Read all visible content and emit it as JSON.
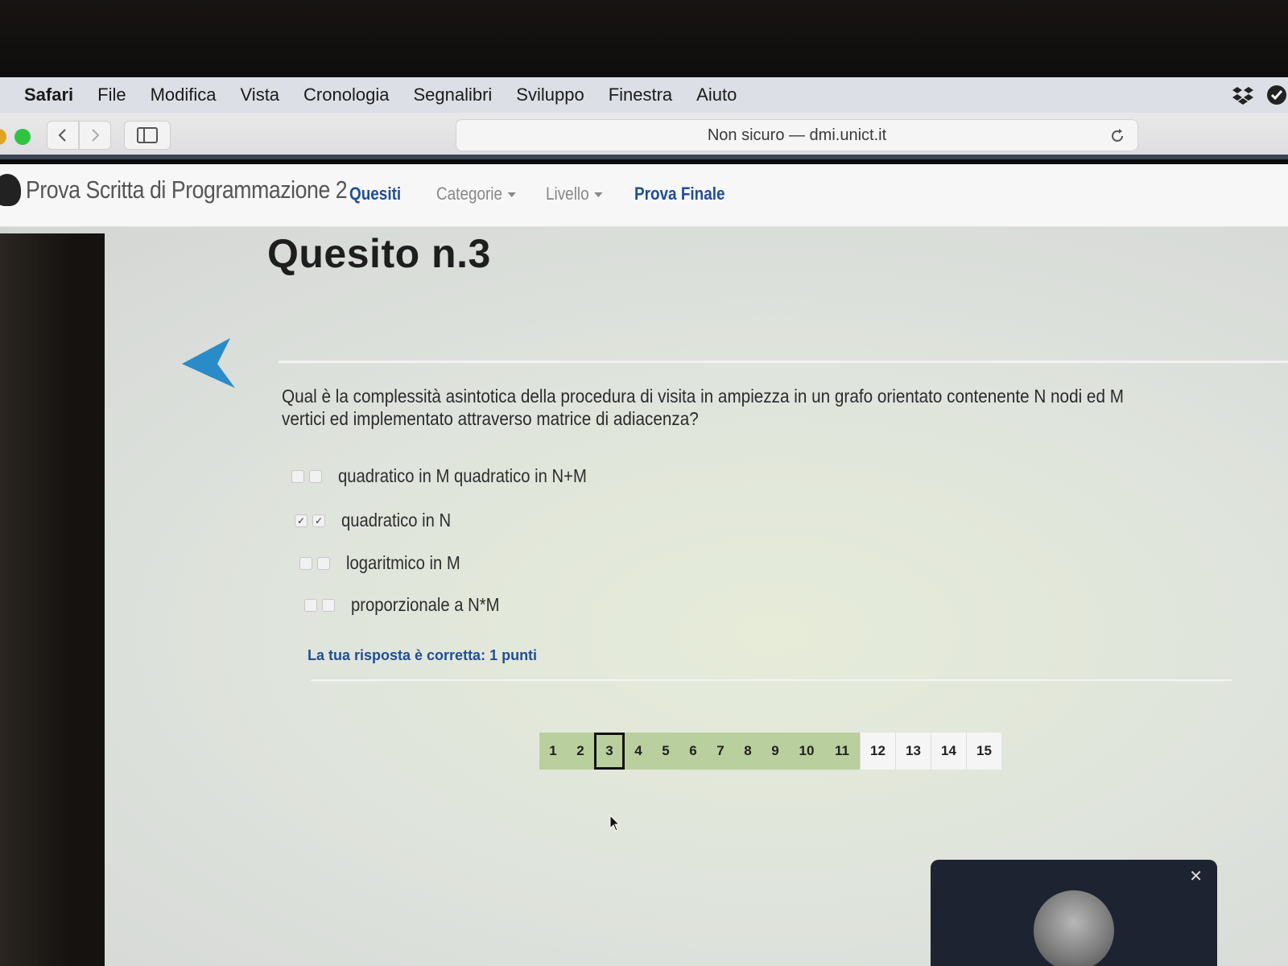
{
  "menubar": {
    "app": "Safari",
    "items": [
      "File",
      "Modifica",
      "Vista",
      "Cronologia",
      "Segnalibri",
      "Sviluppo",
      "Finestra",
      "Aiuto"
    ]
  },
  "toolbar": {
    "url": "Non sicuro — dmi.unict.it"
  },
  "site": {
    "brand": "Prova Scritta di Programmazione 2",
    "nav": {
      "quesiti": "Quesiti",
      "categorie": "Categorie",
      "livello": "Livello",
      "prova_finale": "Prova Finale"
    }
  },
  "question": {
    "title": "Quesito n.3",
    "text": "Qual è la complessità asintotica della procedura di visita in ampiezza in un grafo orientato contenente N nodi ed M vertici ed implementato attraverso matrice di adiacenza?",
    "options": [
      {
        "label": "quadratico in M quadratico in N+M",
        "checked": false
      },
      {
        "label": "quadratico in N",
        "checked": true
      },
      {
        "label": "logaritmico in M",
        "checked": false
      },
      {
        "label": "proporzionale a N*M",
        "checked": false
      }
    ],
    "feedback": "La tua risposta è corretta: 1 punti"
  },
  "pager": {
    "pages": [
      "1",
      "2",
      "3",
      "4",
      "5",
      "6",
      "7",
      "8",
      "9",
      "10",
      "11",
      "12",
      "13",
      "14",
      "15"
    ],
    "current": "3"
  },
  "video": {
    "close": "✕"
  },
  "colors": {
    "accent": "#1f4e94",
    "arrow": "#2a8bc9",
    "answered": "#b9cf9e"
  }
}
